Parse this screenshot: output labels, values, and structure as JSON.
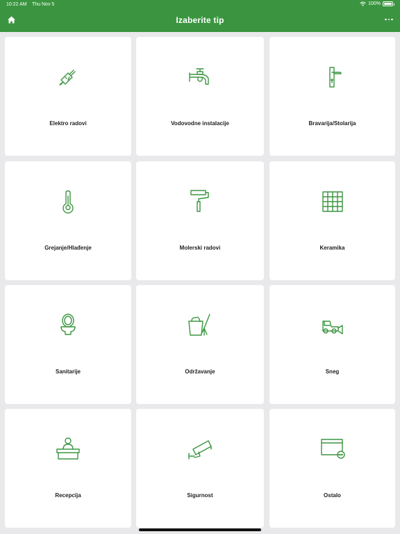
{
  "status": {
    "time": "10:22 AM",
    "date": "Thu Nov 5",
    "battery": "100%"
  },
  "nav": {
    "title": "Izaberite tip",
    "home_icon": "home-icon",
    "more_icon": "more-horizontal-icon"
  },
  "colors": {
    "primary": "#3b9540",
    "background": "#e9e8ea",
    "card": "#ffffff"
  },
  "categories": [
    {
      "label": "Elektro radovi",
      "icon": "plug-icon"
    },
    {
      "label": "Vodovodne instalacije",
      "icon": "faucet-icon"
    },
    {
      "label": "Bravarija/Stolarija",
      "icon": "door-handle-icon"
    },
    {
      "label": "Grejanje/Hlađenje",
      "icon": "thermometer-icon"
    },
    {
      "label": "Molerski radovi",
      "icon": "paint-roller-icon"
    },
    {
      "label": "Keramika",
      "icon": "tiles-icon"
    },
    {
      "label": "Sanitarije",
      "icon": "toilet-icon"
    },
    {
      "label": "Održavanje",
      "icon": "cleaning-icon"
    },
    {
      "label": "Sneg",
      "icon": "snow-plow-icon"
    },
    {
      "label": "Recepcija",
      "icon": "reception-icon"
    },
    {
      "label": "Sigurnost",
      "icon": "security-camera-icon"
    },
    {
      "label": "Ostalo",
      "icon": "other-window-icon"
    }
  ]
}
